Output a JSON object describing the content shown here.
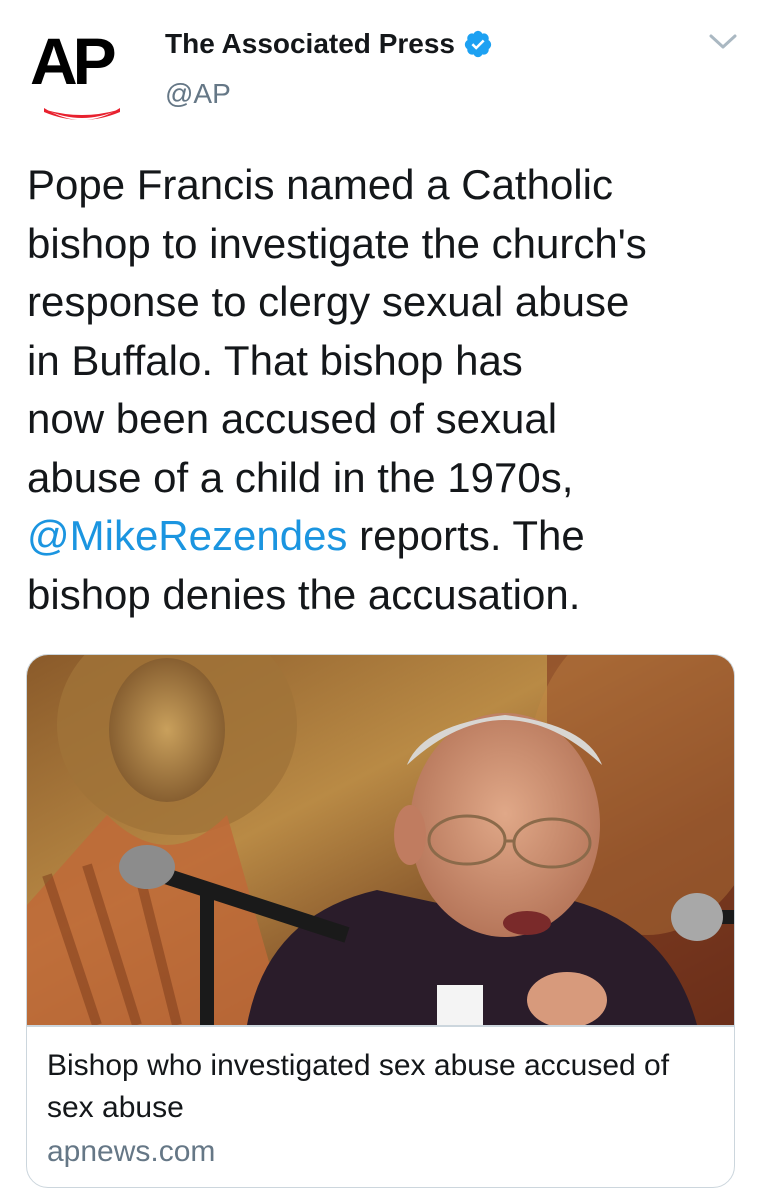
{
  "author": {
    "display_name": "The Associated Press",
    "handle": "@AP",
    "avatar_text": "AP",
    "verified": true,
    "verified_icon": "verified-badge-icon",
    "brand_colors": {
      "logo_text": "#000000",
      "logo_arc": "#e8212f"
    }
  },
  "menu": {
    "icon": "chevron-down-icon"
  },
  "tweet": {
    "lines": [
      {
        "text": "Pope Francis named a Catholic"
      },
      {
        "text": "bishop to investigate the church's"
      },
      {
        "text": "response to clergy sexual abuse"
      },
      {
        "text": "in Buffalo. That bishop has"
      },
      {
        "text": "now been accused of sexual"
      },
      {
        "text": "abuse of a child in the 1970s,"
      },
      {
        "mention": "@MikeRezendes",
        "text": " reports. The"
      },
      {
        "text": "bishop denies the accusation."
      }
    ],
    "mention_color": "#1b95e0"
  },
  "card": {
    "title": "Bishop who investigated sex abuse accused of sex abuse",
    "domain": "apnews.com",
    "image": "photo-bishop-speaking-at-microphone"
  }
}
